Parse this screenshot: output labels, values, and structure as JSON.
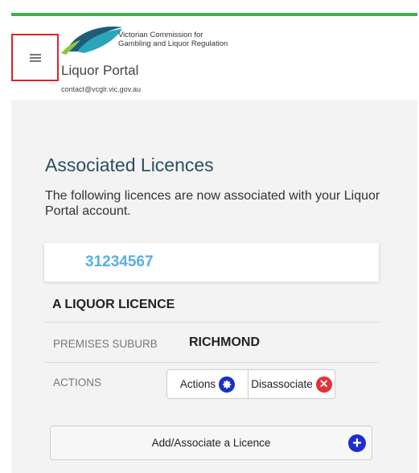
{
  "header": {
    "org_name_line1": "Victorian Commission for",
    "org_name_line2": "Gambling and Liquor Regulation",
    "portal_title": "Liquor Portal",
    "contact_email": "contact@vcglr.vic.gov.au",
    "menu_icon": "hamburger-icon",
    "accent_color": "#3dae49"
  },
  "main": {
    "heading": "Associated Licences",
    "intro": "The following licences are now associated with your Liquor Portal account.",
    "licence": {
      "number": "31234567",
      "name": "A LIQUOR LICENCE",
      "suburb_label": "PREMISES SUBURB",
      "suburb_value": "RICHMOND",
      "actions_label": "ACTIONS",
      "actions_button": "Actions",
      "actions_icon": "gear-icon",
      "disassociate_button": "Disassociate",
      "disassociate_icon": "close-circle-icon"
    },
    "add_button": "Add/Associate a Licence",
    "add_icon": "plus-circle-icon"
  }
}
